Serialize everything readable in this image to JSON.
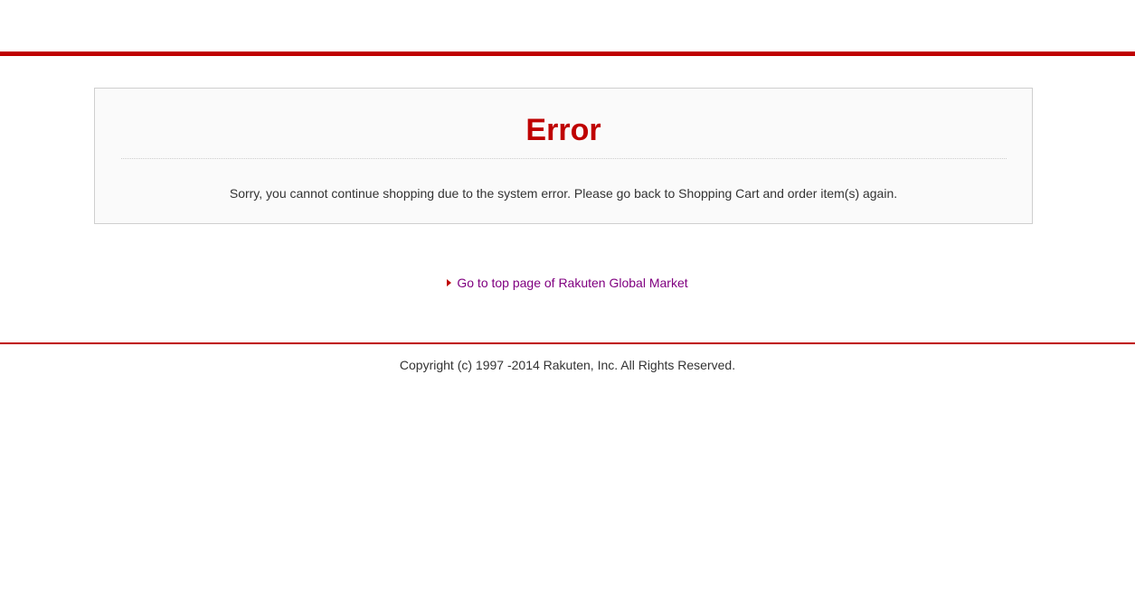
{
  "header": {
    "accent_color": "#bf0000"
  },
  "error": {
    "title": "Error",
    "message": "Sorry, you cannot continue shopping due to the system error. Please go back to Shopping Cart and order item(s) again."
  },
  "links": {
    "top_page_label": "Go to top page of Rakuten Global Market",
    "link_color": "#800080"
  },
  "footer": {
    "copyright": "Copyright (c) 1997 -2014 Rakuten, Inc. All Rights Reserved."
  }
}
